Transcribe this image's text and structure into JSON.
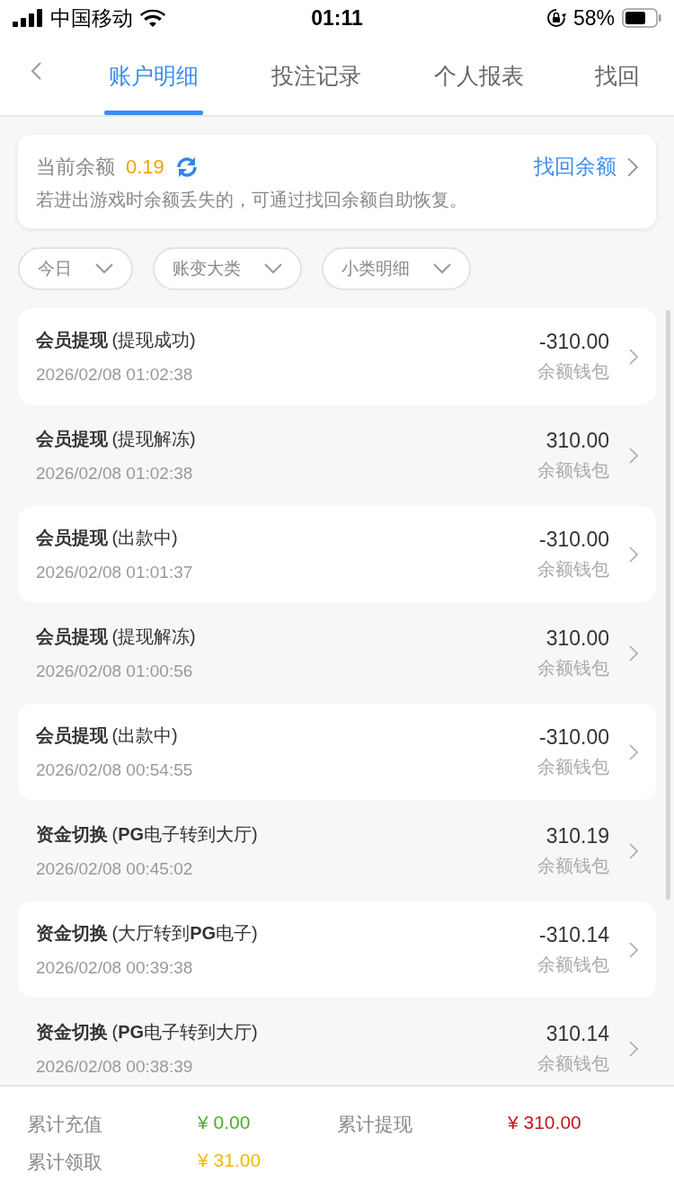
{
  "status_bar": {
    "carrier": "中国移动",
    "time": "01:11",
    "battery": "58%"
  },
  "tabs": [
    {
      "label": "账户明细",
      "selected": true
    },
    {
      "label": "投注记录",
      "selected": false
    },
    {
      "label": "个人报表",
      "selected": false
    },
    {
      "label": "找回",
      "selected": false
    }
  ],
  "balance_card": {
    "label": "当前余额",
    "amount": "0.19",
    "link": "找回余额",
    "note": "若进出游戏时余额丢失的，可通过找回余额自助恢复。"
  },
  "filters": [
    {
      "label": "今日"
    },
    {
      "label": "账变大类"
    },
    {
      "label": "小类明细"
    }
  ],
  "records": [
    {
      "type": "会员提现",
      "detail": "(提现成功)",
      "time": "2026/02/08 01:02:38",
      "amount": "-310.00",
      "wallet": "余额钱包"
    },
    {
      "type": "会员提现",
      "detail": "(提现解冻)",
      "time": "2026/02/08 01:02:38",
      "amount": "310.00",
      "wallet": "余额钱包"
    },
    {
      "type": "会员提现",
      "detail": "(出款中)",
      "time": "2026/02/08 01:01:37",
      "amount": "-310.00",
      "wallet": "余额钱包"
    },
    {
      "type": "会员提现",
      "detail": "(提现解冻)",
      "time": "2026/02/08 01:00:56",
      "amount": "310.00",
      "wallet": "余额钱包"
    },
    {
      "type": "会员提现",
      "detail": "(出款中)",
      "time": "2026/02/08 00:54:55",
      "amount": "-310.00",
      "wallet": "余额钱包"
    },
    {
      "type": "资金切换",
      "detail": "(**PG**电子转到大厅)",
      "time": "2026/02/08 00:45:02",
      "amount": "310.19",
      "wallet": "余额钱包"
    },
    {
      "type": "资金切换",
      "detail": "(大厅转到**PG**电子)",
      "time": "2026/02/08 00:39:38",
      "amount": "-310.14",
      "wallet": "余额钱包"
    },
    {
      "type": "资金切换",
      "detail": "(**PG**电子转到大厅)",
      "time": "2026/02/08 00:38:39",
      "amount": "310.14",
      "wallet": "余额钱包"
    }
  ],
  "summary": [
    {
      "label": "累计充值",
      "value": "¥ 0.00",
      "color": "#4caf2a"
    },
    {
      "label": "累计提现",
      "value": "¥ 310.00",
      "color": "#c8161d"
    },
    {
      "label": "累计领取",
      "value": "¥ 31.00",
      "color": "#f5b800"
    }
  ]
}
